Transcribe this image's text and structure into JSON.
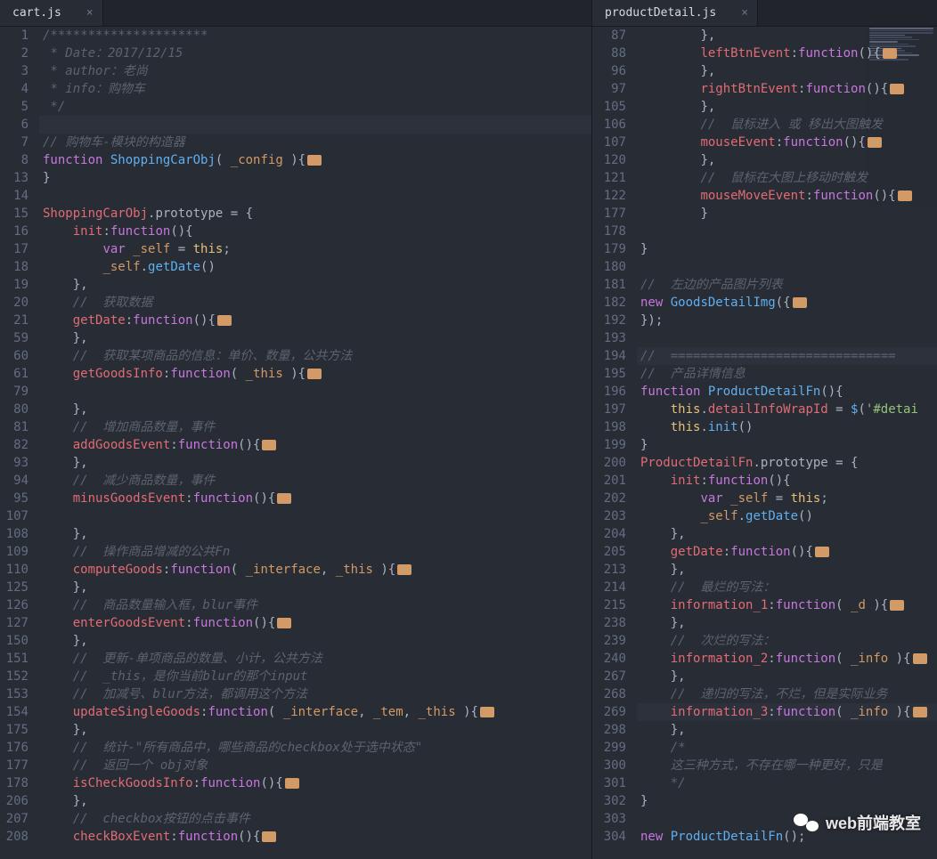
{
  "left": {
    "tab": {
      "name": "cart.js",
      "close": "×"
    },
    "lines": [
      {
        "n": "1",
        "t": "cmt",
        "txt": "/*********************"
      },
      {
        "n": "2",
        "t": "cmt",
        "txt": " * Date：2017/12/15"
      },
      {
        "n": "3",
        "t": "cmt",
        "txt": " * author：老尚"
      },
      {
        "n": "4",
        "t": "cmt",
        "txt": " * info：购物车"
      },
      {
        "n": "5",
        "t": "cmt",
        "txt": " */"
      },
      {
        "n": "6",
        "t": "",
        "txt": "",
        "hl": true
      },
      {
        "n": "7",
        "t": "cmt",
        "txt": "// 购物车-模块的构造器"
      },
      {
        "n": "8",
        "t": "fndecl",
        "kw": "function",
        "name": "ShoppingCarObj",
        "params": "_config",
        "fold": true
      },
      {
        "n": "13",
        "t": "pn",
        "txt": "}"
      },
      {
        "n": "14",
        "t": "",
        "txt": ""
      },
      {
        "n": "15",
        "t": "proto",
        "obj": "ShoppingCarObj",
        "txt": ".prototype = {"
      },
      {
        "n": "16",
        "t": "method",
        "indent": 1,
        "name": "init",
        "params": "",
        "open": true
      },
      {
        "n": "17",
        "t": "raw",
        "indent": 2,
        "html": "<span class='kw'>var</span> <span class='param'>_self</span> = <span class='this'>this</span>;"
      },
      {
        "n": "18",
        "t": "raw",
        "indent": 2,
        "html": "<span class='param'>_self</span>.<span class='fn'>getDate</span>()"
      },
      {
        "n": "19",
        "t": "closeM",
        "indent": 1
      },
      {
        "n": "20",
        "t": "cmti",
        "indent": 1,
        "txt": "//  获取数据"
      },
      {
        "n": "21",
        "t": "method",
        "indent": 1,
        "name": "getDate",
        "params": "",
        "fold": true
      },
      {
        "n": "59",
        "t": "closeM",
        "indent": 1
      },
      {
        "n": "60",
        "t": "cmti",
        "indent": 1,
        "txt": "//  获取某项商品的信息：单价、数量，公共方法"
      },
      {
        "n": "61",
        "t": "method",
        "indent": 1,
        "name": "getGoodsInfo",
        "params": "_this",
        "fold": true
      },
      {
        "n": "79",
        "t": "",
        "txt": ""
      },
      {
        "n": "80",
        "t": "closeM",
        "indent": 1
      },
      {
        "n": "81",
        "t": "cmti",
        "indent": 1,
        "txt": "//  增加商品数量，事件"
      },
      {
        "n": "82",
        "t": "method",
        "indent": 1,
        "name": "addGoodsEvent",
        "params": "",
        "fold": true
      },
      {
        "n": "93",
        "t": "closeM",
        "indent": 1
      },
      {
        "n": "94",
        "t": "cmti",
        "indent": 1,
        "txt": "//  减少商品数量，事件"
      },
      {
        "n": "95",
        "t": "method",
        "indent": 1,
        "name": "minusGoodsEvent",
        "params": "",
        "fold": true
      },
      {
        "n": "107",
        "t": "",
        "txt": ""
      },
      {
        "n": "108",
        "t": "closeM",
        "indent": 1
      },
      {
        "n": "109",
        "t": "cmti",
        "indent": 1,
        "txt": "//  操作商品增减的公共Fn"
      },
      {
        "n": "110",
        "t": "method",
        "indent": 1,
        "name": "computeGoods",
        "params": "_interface, _this",
        "fold": true
      },
      {
        "n": "125",
        "t": "closeM",
        "indent": 1
      },
      {
        "n": "126",
        "t": "cmti",
        "indent": 1,
        "txt": "//  商品数量输入框，blur事件"
      },
      {
        "n": "127",
        "t": "method",
        "indent": 1,
        "name": "enterGoodsEvent",
        "params": "",
        "fold": true
      },
      {
        "n": "150",
        "t": "closeM",
        "indent": 1
      },
      {
        "n": "151",
        "t": "cmti",
        "indent": 1,
        "txt": "//  更新-单项商品的数量、小计，公共方法"
      },
      {
        "n": "152",
        "t": "cmti",
        "indent": 1,
        "txt": "//  _this，是你当前blur的那个input"
      },
      {
        "n": "153",
        "t": "cmti",
        "indent": 1,
        "txt": "//  加减号、blur方法，都调用这个方法"
      },
      {
        "n": "154",
        "t": "method",
        "indent": 1,
        "name": "updateSingleGoods",
        "params": "_interface, _tem, _this",
        "fold": true
      },
      {
        "n": "175",
        "t": "closeM",
        "indent": 1
      },
      {
        "n": "176",
        "t": "cmti",
        "indent": 1,
        "txt": "//  统计-\"所有商品中，哪些商品的checkbox处于选中状态\""
      },
      {
        "n": "177",
        "t": "cmti",
        "indent": 1,
        "txt": "//  返回一个 obj对象"
      },
      {
        "n": "178",
        "t": "method",
        "indent": 1,
        "name": "isCheckGoodsInfo",
        "params": "",
        "fold": true
      },
      {
        "n": "206",
        "t": "closeM",
        "indent": 1
      },
      {
        "n": "207",
        "t": "cmti",
        "indent": 1,
        "txt": "//  checkbox按钮的点击事件"
      },
      {
        "n": "208",
        "t": "method",
        "indent": 1,
        "name": "checkBoxEvent",
        "params": "",
        "fold": true
      }
    ]
  },
  "right": {
    "tab": {
      "name": "productDetail.js",
      "close": "×"
    },
    "lines": [
      {
        "n": "87",
        "t": "closeM",
        "indent": 2
      },
      {
        "n": "88",
        "t": "method",
        "indent": 2,
        "name": "leftBtnEvent",
        "params": "",
        "fold": true
      },
      {
        "n": "96",
        "t": "closeM",
        "indent": 2
      },
      {
        "n": "97",
        "t": "method",
        "indent": 2,
        "name": "rightBtnEvent",
        "params": "",
        "fold": true
      },
      {
        "n": "105",
        "t": "closeM",
        "indent": 2
      },
      {
        "n": "106",
        "t": "cmti",
        "indent": 2,
        "txt": "//  鼠标进入 或 移出大图触发"
      },
      {
        "n": "107",
        "t": "method",
        "indent": 2,
        "name": "mouseEvent",
        "params": "",
        "fold": true
      },
      {
        "n": "120",
        "t": "closeM",
        "indent": 2
      },
      {
        "n": "121",
        "t": "cmti",
        "indent": 2,
        "txt": "//  鼠标在大图上移动时触发"
      },
      {
        "n": "122",
        "t": "method",
        "indent": 2,
        "name": "mouseMoveEvent",
        "params": "",
        "fold": true
      },
      {
        "n": "177",
        "t": "closeNoC",
        "indent": 2
      },
      {
        "n": "178",
        "t": "",
        "txt": ""
      },
      {
        "n": "179",
        "t": "pn",
        "txt": "}"
      },
      {
        "n": "180",
        "t": "",
        "txt": ""
      },
      {
        "n": "181",
        "t": "cmt",
        "txt": "//  左边的产品图片列表"
      },
      {
        "n": "182",
        "t": "newcall",
        "kw": "new",
        "name": "GoodsDetailImg",
        "txt": "({",
        "fold": true
      },
      {
        "n": "192",
        "t": "pn",
        "txt": "});"
      },
      {
        "n": "193",
        "t": "",
        "txt": ""
      },
      {
        "n": "194",
        "t": "cmt",
        "txt": "//  ==============================",
        "hl": true
      },
      {
        "n": "195",
        "t": "cmt",
        "txt": "//  产品详情信息"
      },
      {
        "n": "196",
        "t": "fndecl",
        "kw": "function",
        "name": "ProductDetailFn",
        "params": "",
        "open": true
      },
      {
        "n": "197",
        "t": "raw",
        "indent": 1,
        "html": "<span class='this'>this</span>.<span class='prop'>detailInfoWrapId</span> = <span class='fn'>$</span>(<span class='str'>'#detai</span>"
      },
      {
        "n": "198",
        "t": "raw",
        "indent": 1,
        "html": "<span class='this'>this</span>.<span class='fn'>init</span>()"
      },
      {
        "n": "199",
        "t": "pn",
        "txt": "}"
      },
      {
        "n": "200",
        "t": "proto",
        "obj": "ProductDetailFn",
        "txt": ".prototype = {"
      },
      {
        "n": "201",
        "t": "method",
        "indent": 1,
        "name": "init",
        "params": "",
        "open": true
      },
      {
        "n": "202",
        "t": "raw",
        "indent": 2,
        "html": "<span class='kw'>var</span> <span class='param'>_self</span> = <span class='this'>this</span>;"
      },
      {
        "n": "203",
        "t": "raw",
        "indent": 2,
        "html": "<span class='param'>_self</span>.<span class='fn'>getDate</span>()"
      },
      {
        "n": "204",
        "t": "closeM",
        "indent": 1
      },
      {
        "n": "205",
        "t": "method",
        "indent": 1,
        "name": "getDate",
        "params": "",
        "fold": true
      },
      {
        "n": "213",
        "t": "closeM",
        "indent": 1
      },
      {
        "n": "214",
        "t": "cmti",
        "indent": 1,
        "txt": "//  最烂的写法："
      },
      {
        "n": "215",
        "t": "method",
        "indent": 1,
        "name": "information_1",
        "params": "_d",
        "fold": true
      },
      {
        "n": "238",
        "t": "closeM",
        "indent": 1
      },
      {
        "n": "239",
        "t": "cmti",
        "indent": 1,
        "txt": "//  次烂的写法："
      },
      {
        "n": "240",
        "t": "method",
        "indent": 1,
        "name": "information_2",
        "params": "_info",
        "fold": true
      },
      {
        "n": "267",
        "t": "closeM",
        "indent": 1
      },
      {
        "n": "268",
        "t": "cmti",
        "indent": 1,
        "txt": "//  递归的写法，不烂，但是实际业务"
      },
      {
        "n": "269",
        "t": "method",
        "indent": 1,
        "name": "information_3",
        "params": "_info",
        "fold": true,
        "hl": true
      },
      {
        "n": "298",
        "t": "closeM",
        "indent": 1
      },
      {
        "n": "299",
        "t": "cmti",
        "indent": 1,
        "txt": "/*"
      },
      {
        "n": "300",
        "t": "cmti",
        "indent": 1,
        "txt": "这三种方式，不存在哪一种更好，只是"
      },
      {
        "n": "301",
        "t": "cmti",
        "indent": 1,
        "txt": "*/"
      },
      {
        "n": "302",
        "t": "pn",
        "txt": "}"
      },
      {
        "n": "303",
        "t": "",
        "txt": ""
      },
      {
        "n": "304",
        "t": "newcall",
        "kw": "new",
        "name": "ProductDetailFn",
        "txt": "();",
        "fold": false
      }
    ]
  },
  "watermark": "web前端教室"
}
